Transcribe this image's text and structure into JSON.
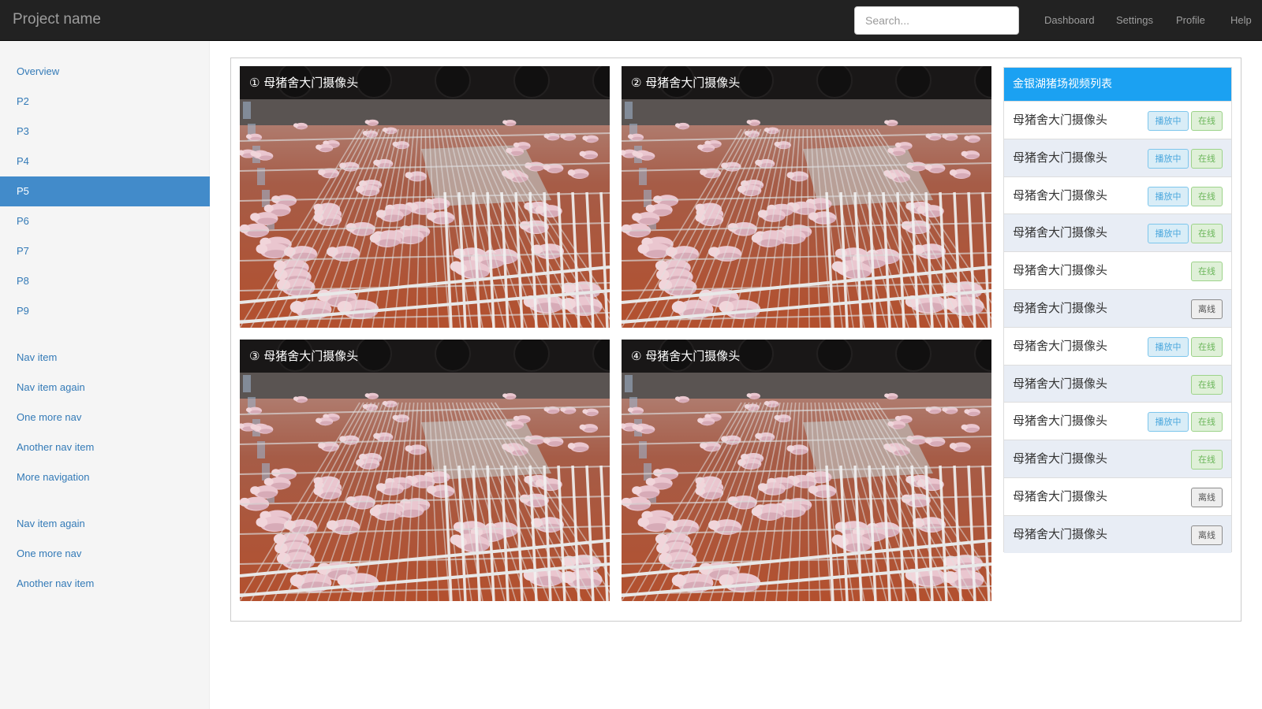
{
  "navbar": {
    "brand": "Project name",
    "search_placeholder": "Search...",
    "links": [
      "Dashboard",
      "Settings",
      "Profile",
      "Help"
    ]
  },
  "sidebar": {
    "group1": [
      "Overview",
      "P2",
      "P3",
      "P4",
      "P5",
      "P6",
      "P7",
      "P8",
      "P9"
    ],
    "active": "P5",
    "group2": [
      "Nav item",
      "Nav item again",
      "One more nav",
      "Another nav item",
      "More navigation"
    ],
    "group3": [
      "Nav item again",
      "One more nav",
      "Another nav item"
    ]
  },
  "cameras": [
    {
      "title": "① 母猪舍大门摄像头"
    },
    {
      "title": "② 母猪舍大门摄像头"
    },
    {
      "title": "③ 母猪舍大门摄像头"
    },
    {
      "title": "④ 母猪舍大门摄像头"
    }
  ],
  "video_list": {
    "header": "金银湖猪场视频列表",
    "playing_label": "播放中",
    "online_label": "在线",
    "offline_label": "离线",
    "rows": [
      {
        "name": "母猪舍大门摄像头",
        "playing": true,
        "status": "online"
      },
      {
        "name": "母猪舍大门摄像头",
        "playing": true,
        "status": "online"
      },
      {
        "name": "母猪舍大门摄像头",
        "playing": true,
        "status": "online"
      },
      {
        "name": "母猪舍大门摄像头",
        "playing": true,
        "status": "online"
      },
      {
        "name": "母猪舍大门摄像头",
        "playing": false,
        "status": "online"
      },
      {
        "name": "母猪舍大门摄像头",
        "playing": false,
        "status": "offline"
      },
      {
        "name": "母猪舍大门摄像头",
        "playing": true,
        "status": "online"
      },
      {
        "name": "母猪舍大门摄像头",
        "playing": false,
        "status": "online"
      },
      {
        "name": "母猪舍大门摄像头",
        "playing": true,
        "status": "online"
      },
      {
        "name": "母猪舍大门摄像头",
        "playing": false,
        "status": "online"
      },
      {
        "name": "母猪舍大门摄像头",
        "playing": false,
        "status": "offline"
      },
      {
        "name": "母猪舍大门摄像头",
        "playing": false,
        "status": "offline"
      }
    ]
  },
  "colors": {
    "navbar_bg": "#222222",
    "active_item": "#428bca",
    "list_header": "#1ba1f2",
    "tag_play": "#4aa7dd",
    "tag_online": "#6bb65a",
    "tag_offline": "#555555"
  }
}
